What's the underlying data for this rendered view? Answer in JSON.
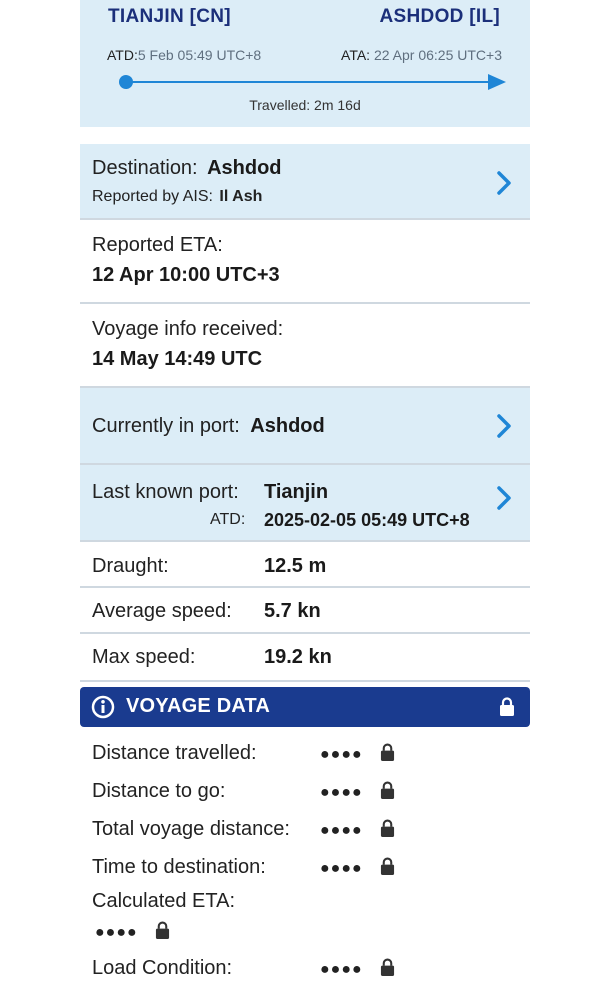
{
  "route": {
    "from_port": "TIANJIN [CN]",
    "to_port": "ASHDOD [IL]",
    "atd_label": "ATD:",
    "atd_value": "5 Feb 05:49 UTC+8",
    "ata_label": "ATA:",
    "ata_value": "22 Apr 06:25 UTC+3",
    "travelled": "Travelled: 2m 16d"
  },
  "destination": {
    "label": "Destination:",
    "value": "Ashdod",
    "reported_label": "Reported by AIS:",
    "reported_value": "Il Ash"
  },
  "reported_eta": {
    "label": "Reported ETA:",
    "value": "12 Apr 10:00 UTC+3"
  },
  "voyage_info": {
    "label": "Voyage info received:",
    "value": "14 May 14:49 UTC"
  },
  "current_port": {
    "label": "Currently in port:",
    "value": "Ashdod"
  },
  "last_port": {
    "label": "Last known port:",
    "value": "Tianjin",
    "atd_label": "ATD:",
    "atd_value": "2025-02-05 05:49 UTC+8"
  },
  "stats": [
    {
      "label": "Draught:",
      "value": "12.5 m"
    },
    {
      "label": "Average speed:",
      "value": "5.7 kn"
    },
    {
      "label": "Max speed:",
      "value": "19.2 kn"
    }
  ],
  "voyage_data": {
    "title": "VOYAGE DATA",
    "masked": "●●●●",
    "rows": [
      {
        "label": "Distance travelled:"
      },
      {
        "label": "Distance to go:"
      },
      {
        "label": "Total voyage distance:"
      },
      {
        "label": "Time to destination:"
      },
      {
        "label": "Calculated ETA:"
      },
      {
        "label": "Load Condition:"
      }
    ]
  },
  "colors": {
    "accent": "#1f86d6",
    "header": "#1a3b8f",
    "panel": "#dcedf7",
    "title": "#1b2f7a"
  },
  "icons": [
    "info-icon",
    "lock-icon",
    "chevron-right-icon"
  ]
}
